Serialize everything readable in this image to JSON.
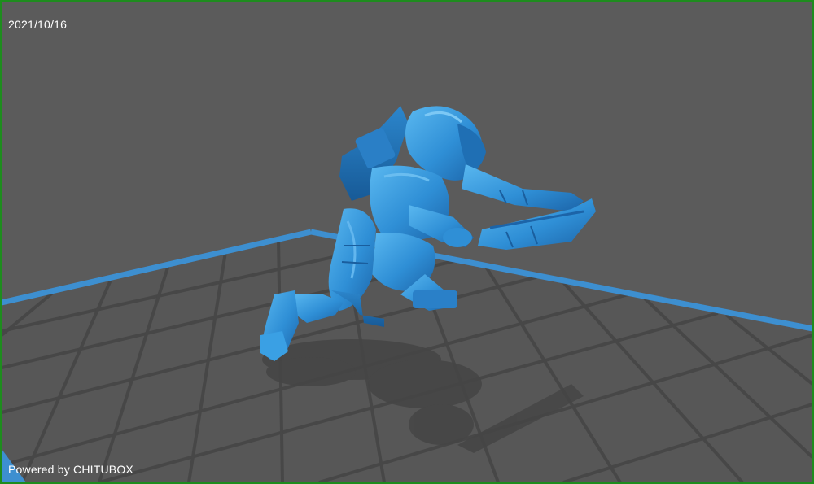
{
  "viewer": {
    "date": "2021/10/16",
    "powered_by": "Powered by CHITUBOX"
  },
  "scene": {
    "build_plate": "grid",
    "model": "armored-figure-model",
    "colors": {
      "background": "#5b5b5b",
      "grid_line": "#4a4a4a",
      "plate_edge": "#3d8fd0",
      "model": "#2f8fd6",
      "frame": "#1e8c1e"
    }
  }
}
